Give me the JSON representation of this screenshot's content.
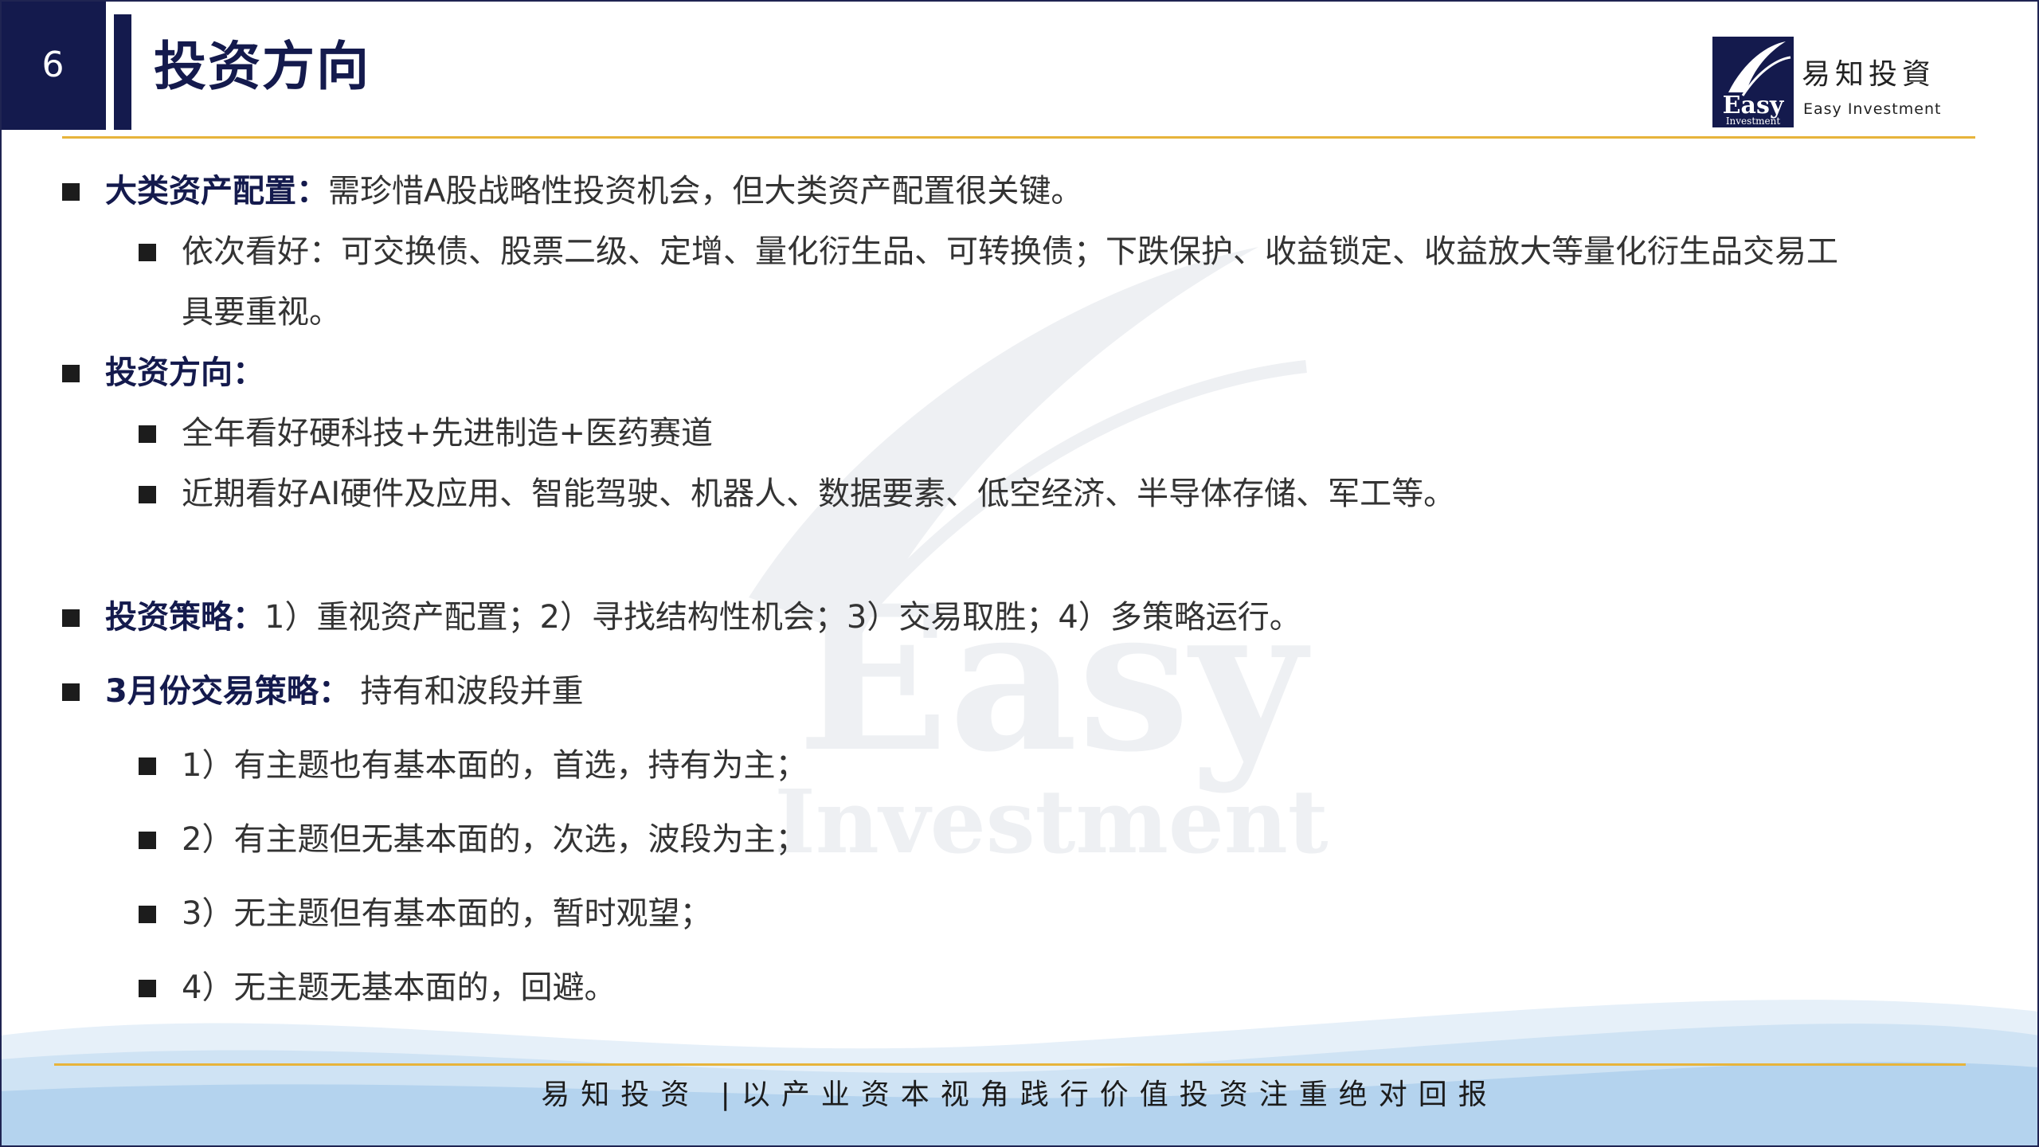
{
  "header": {
    "page_number": "6",
    "title": "投资方向",
    "logo_zh": "易知投資",
    "logo_en": "Easy Investment",
    "logo_mark_word": "Easy",
    "logo_mark_sub": "Investment"
  },
  "watermark": {
    "word": "Easy",
    "sub": "Investment"
  },
  "content": {
    "b1_lead": "大类资产配置：",
    "b1_text": "需珍惜A股战略性投资机会，但大类资产配置很关键。",
    "b1_sub1_line1": "依次看好：可交换债、股票二级、定增、量化衍生品、可转换债；下跌保护、收益锁定、收益放大等量化衍生品交易工",
    "b1_sub1_line2": "具要重视。",
    "b2_lead": "投资方向：",
    "b2_sub1": "全年看好硬科技+先进制造+医药赛道",
    "b2_sub2": "近期看好AI硬件及应用、智能驾驶、机器人、数据要素、低空经济、半导体存储、军工等。",
    "b3_lead": "投资策略：",
    "b3_text": "1）重视资产配置；2）寻找结构性机会；3）交易取胜；4）多策略运行。",
    "b4_lead": "3月份交易策略：",
    "b4_text": " 持有和波段并重",
    "b4_sub1": "1）有主题也有基本面的，首选，持有为主；",
    "b4_sub2": "2）有主题但无基本面的，次选，波段为主；",
    "b4_sub3": "3）无主题但有基本面的，暂时观望；",
    "b4_sub4": "4）无主题无基本面的，回避。"
  },
  "footer": {
    "slogan": "易知投资 |以产业资本视角践行价值投资注重绝对回报"
  },
  "colors": {
    "navy": "#141a4d",
    "gold_rule": "#e7b43b",
    "wave_light": "#dbe9f6",
    "wave_mid": "#b4d3ee"
  }
}
